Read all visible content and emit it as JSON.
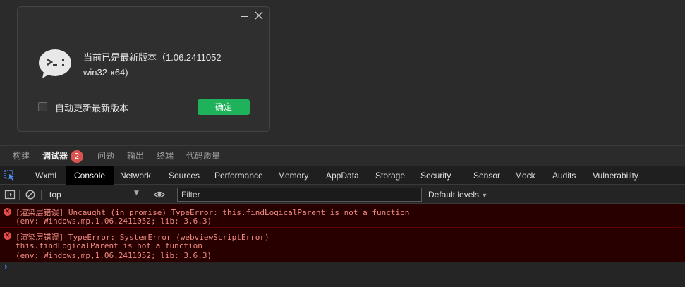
{
  "dialog": {
    "message": "当前已是最新版本（1.06.2411052 win32-x64)",
    "checkbox_label": "自动更新最新版本",
    "ok_label": "确定",
    "minimize_icon": "minimize-icon",
    "close_icon": "close-icon"
  },
  "topnav": {
    "items": [
      "构建",
      "调试器",
      "问题",
      "输出",
      "终端",
      "代码质量"
    ],
    "active": "调试器",
    "debugger_badge": "2"
  },
  "tabs": [
    "Wxml",
    "Console",
    "Network",
    "Sources",
    "Performance",
    "Memory",
    "AppData",
    "Storage",
    "Security",
    "Sensor",
    "Mock",
    "Audits",
    "Vulnerability"
  ],
  "active_tab": "Console",
  "toolbar": {
    "context": "top",
    "filter_placeholder": "Filter",
    "levels": "Default levels"
  },
  "console": {
    "messages": [
      {
        "lines": [
          "[渲染层错误] Uncaught (in promise) TypeError: this.findLogicalParent is not a function",
          "(env: Windows,mp,1.06.2411052; lib: 3.6.3)"
        ]
      },
      {
        "lines": [
          "[渲染层错误] TypeError: SystemError (webviewScriptError)",
          "this.findLogicalParent is not a function",
          "(env: Windows,mp,1.06.2411052; lib: 3.6.3)"
        ]
      }
    ],
    "prompt": "›"
  },
  "colors": {
    "accent_green": "#1fb25a",
    "error_bg": "#290000",
    "error_text": "#f28b82",
    "badge": "#d9534f"
  }
}
